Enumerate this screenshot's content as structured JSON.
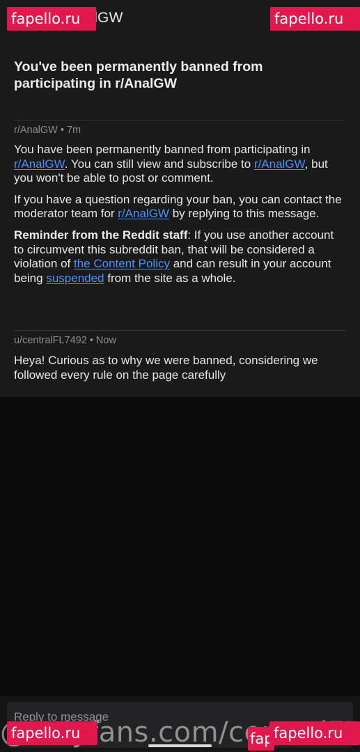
{
  "header": {
    "title": "r/AnalGW"
  },
  "watermarks": {
    "top_left": "fapello.ru",
    "top_right": "fapello.ru",
    "bottom_left": "fapello.ru",
    "bottom_right": "fapello.ru",
    "bottom_middle": "fap",
    "bottom_overlay": "@onlyfans.com/centralFL7492"
  },
  "message": {
    "subject": "You've been permanently banned from participating in r/AnalGW",
    "first": {
      "meta": "r/AnalGW • 7m",
      "p1_text1": "You have been permanently banned from participating in ",
      "p1_link1": "r/AnalGW",
      "p1_text2": ". You can still view and subscribe to ",
      "p1_link2": "r/AnalGW",
      "p1_text3": ", but you won't be able to post or comment.",
      "p2_text1": "If you have a question regarding your ban, you can contact the moderator team for ",
      "p2_link": "r/AnalGW",
      "p2_text2": " by replying to this message.",
      "p3_bold": "Reminder from the Reddit staff",
      "p3_text1": ": If you use another account to circumvent this subreddit ban, that will be considered a violation of ",
      "p3_link1": "the Content Policy",
      "p3_text2": " and can result in your account being ",
      "p3_link2": "suspended",
      "p3_text3": " from the site as a whole."
    },
    "reply": {
      "meta": "u/centralFL7492 • Now",
      "text": "Heya! Curious as to why we were banned, considering we followed every rule on the page carefully"
    }
  },
  "composer": {
    "placeholder": "Reply to message"
  },
  "colors": {
    "background": "#0b0b0c",
    "panel": "#1a1a1b",
    "link": "#4f8ff7",
    "watermark": "#e2174e"
  },
  "icons": {
    "back": "arrow-left-icon"
  }
}
